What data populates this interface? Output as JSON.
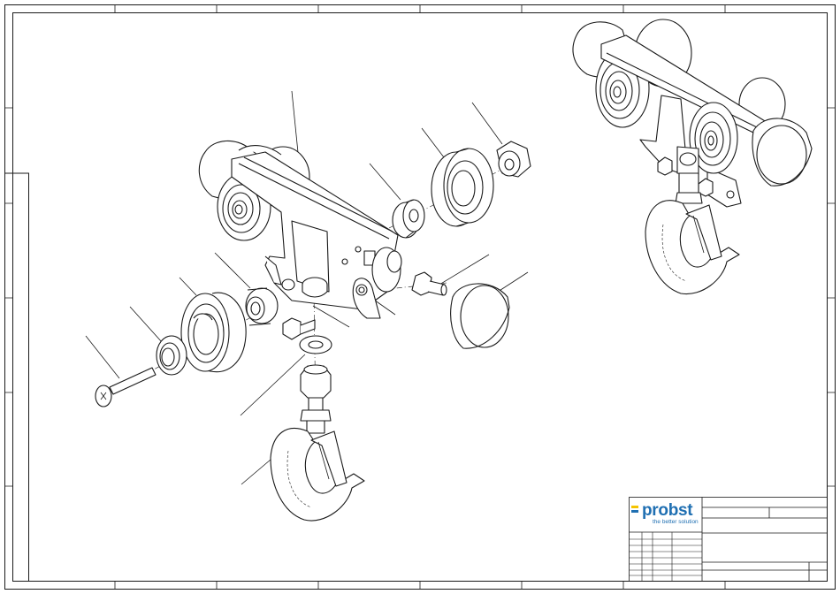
{
  "title_block": {
    "logo_text": "probst",
    "logo_tagline": "the better solution"
  },
  "colors": {
    "line": "#1a1a1a",
    "logo_blue": "#1f6fb2",
    "logo_yellow": "#f5c400"
  },
  "views": [
    "exploded-view",
    "assembled-view"
  ]
}
